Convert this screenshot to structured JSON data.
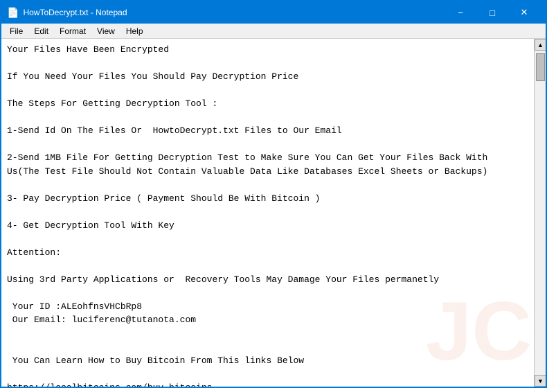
{
  "window": {
    "title": "HowToDecrypt.txt - Notepad"
  },
  "titlebar": {
    "icon": "📄",
    "minimize_label": "−",
    "maximize_label": "□",
    "close_label": "✕"
  },
  "menubar": {
    "items": [
      "File",
      "Edit",
      "Format",
      "View",
      "Help"
    ]
  },
  "content": {
    "text": "Your Files Have Been Encrypted\n\nIf You Need Your Files You Should Pay Decryption Price\n\nThe Steps For Getting Decryption Tool :\n\n1-Send Id On The Files Or  HowtoDecrypt.txt Files to Our Email\n\n2-Send 1MB File For Getting Decryption Test to Make Sure You Can Get Your Files Back With\nUs(The Test File Should Not Contain Valuable Data Like Databases Excel Sheets or Backups)\n\n3- Pay Decryption Price ( Payment Should Be With Bitcoin )\n\n4- Get Decryption Tool With Key\n\nAttention:\n\nUsing 3rd Party Applications or  Recovery Tools May Damage Your Files permanetly\n\n Your ID :ALEohfnsVHCbRp8\n Our Email: luciferenc@tutanota.com\n\n\n You Can Learn How to Buy Bitcoin From This links Below\n\nhttps://localbitcoins.com/buy_bitcoins\n\nhttps://www.coindesk.com/information/how-can-i-buy-bitcoins"
  }
}
